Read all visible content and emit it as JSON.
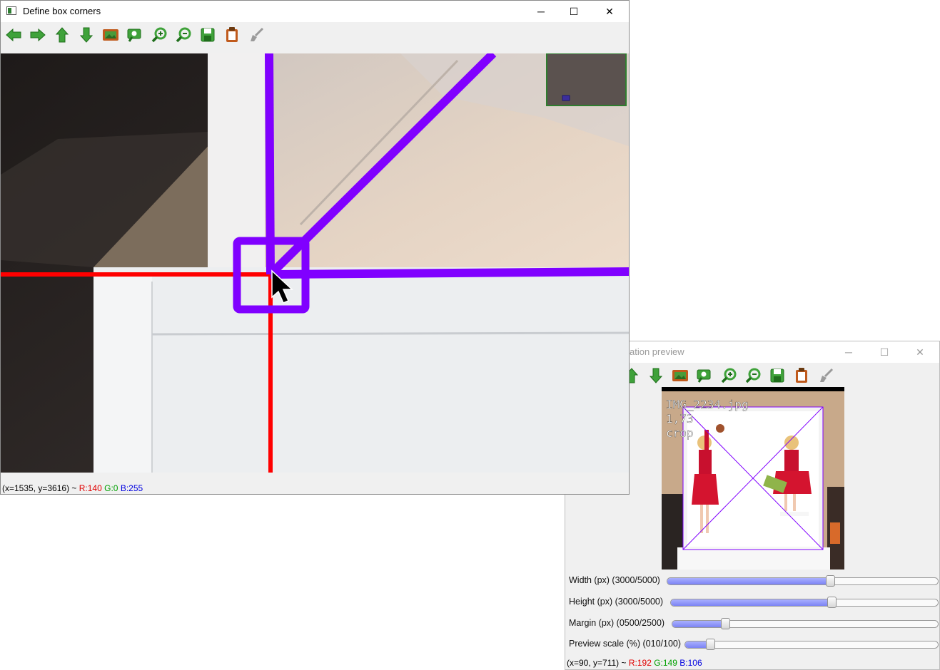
{
  "main_window": {
    "title": "Define box corners",
    "controls": {
      "minimize": "─",
      "maximize": "☐",
      "close": "✕"
    },
    "toolbar": [
      {
        "name": "arrow-left-icon",
        "color": "#3fa23a"
      },
      {
        "name": "arrow-right-icon",
        "color": "#3fa23a"
      },
      {
        "name": "arrow-up-icon",
        "color": "#3fa23a"
      },
      {
        "name": "arrow-down-icon",
        "color": "#3fa23a"
      },
      {
        "name": "image-icon",
        "color": "#c05a1c"
      },
      {
        "name": "zoom-region-icon",
        "color": "#3fa23a"
      },
      {
        "name": "zoom-in-icon",
        "color": "#3fa23a"
      },
      {
        "name": "zoom-out-icon",
        "color": "#3fa23a"
      },
      {
        "name": "save-icon",
        "color": "#3fa23a"
      },
      {
        "name": "clipboard-icon",
        "color": "#c05a1c"
      },
      {
        "name": "brush-icon",
        "color": "#9a9a9a"
      }
    ],
    "status": {
      "coords": "(x=1535, y=3616) ~ ",
      "r": "R:140",
      "g": "G:0",
      "b": "B:255"
    },
    "colors": {
      "box_line": "#8000ff",
      "crosshair": "#ff0000"
    }
  },
  "preview_window": {
    "title": "ation preview",
    "controls": {
      "minimize": "─",
      "maximize": "☐",
      "close": "✕"
    },
    "toolbar": [
      {
        "name": "arrow-up-icon",
        "color": "#3fa23a"
      },
      {
        "name": "arrow-down-icon",
        "color": "#3fa23a"
      },
      {
        "name": "image-icon",
        "color": "#c05a1c"
      },
      {
        "name": "zoom-region-icon",
        "color": "#3fa23a"
      },
      {
        "name": "zoom-in-icon",
        "color": "#3fa23a"
      },
      {
        "name": "zoom-out-icon",
        "color": "#3fa23a"
      },
      {
        "name": "save-icon",
        "color": "#3fa23a"
      },
      {
        "name": "clipboard-icon",
        "color": "#c05a1c"
      },
      {
        "name": "brush-icon",
        "color": "#9a9a9a"
      }
    ],
    "overlay_text": {
      "line1": "IMG_2234.jpg",
      "line2": "1,73",
      "line3": "crop"
    },
    "sliders": [
      {
        "label": "Width (px) (3000/5000)",
        "value": 3000,
        "max": 5000
      },
      {
        "label": "Height (px) (3000/5000)",
        "value": 3000,
        "max": 5000
      },
      {
        "label": "Margin (px) (0500/2500)",
        "value": 500,
        "max": 2500
      },
      {
        "label": "Preview scale (%) (010/100)",
        "value": 10,
        "max": 100
      }
    ],
    "status": {
      "coords": "(x=90, y=711) ~ ",
      "r": "R:192",
      "g": "G:149",
      "b": "B:106"
    }
  }
}
